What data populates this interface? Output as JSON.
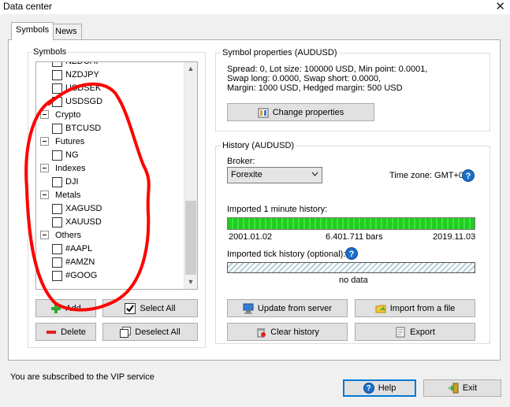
{
  "window": {
    "title": "Data center",
    "close_glyph": "✕"
  },
  "tabs": [
    {
      "label": "Symbols",
      "active": true
    },
    {
      "label": "News",
      "active": false
    }
  ],
  "symbols_group": {
    "title": "Symbols",
    "items": [
      {
        "type": "symbol",
        "label": "NZDCHF"
      },
      {
        "type": "symbol",
        "label": "NZDJPY"
      },
      {
        "type": "symbol",
        "label": "USDSEK"
      },
      {
        "type": "symbol",
        "label": "USDSGD"
      },
      {
        "type": "group",
        "label": "Crypto"
      },
      {
        "type": "symbol",
        "label": "BTCUSD"
      },
      {
        "type": "group",
        "label": "Futures"
      },
      {
        "type": "symbol",
        "label": "NG"
      },
      {
        "type": "group",
        "label": "Indexes"
      },
      {
        "type": "symbol",
        "label": "DJI"
      },
      {
        "type": "group",
        "label": "Metals"
      },
      {
        "type": "symbol",
        "label": "XAGUSD"
      },
      {
        "type": "symbol",
        "label": "XAUUSD"
      },
      {
        "type": "group",
        "label": "Others"
      },
      {
        "type": "symbol",
        "label": "#AAPL"
      },
      {
        "type": "symbol",
        "label": "#AMZN"
      },
      {
        "type": "symbol",
        "label": "#GOOG"
      }
    ],
    "buttons": {
      "add": "Add",
      "select_all": "Select All",
      "delete": "Delete",
      "deselect_all": "Deselect All"
    }
  },
  "symbol_properties": {
    "title": "Symbol properties (AUDUSD)",
    "lines": [
      "Spread: 0, Lot size: 100000 USD, Min point: 0.0001,",
      "Swap long: 0.0000, Swap short: 0.0000,",
      "Margin: 1000 USD, Hedged margin: 500 USD"
    ],
    "change_button": "Change properties"
  },
  "history": {
    "title": "History (AUDUSD)",
    "broker_label": "Broker:",
    "broker_value": "Forexite",
    "timezone_label": "Time zone: GMT+0",
    "minute_label": "Imported 1 minute history:",
    "minute_progress": 1.0,
    "minute_start": "2001.01.02",
    "minute_bars": "6.401.711 bars",
    "minute_end": "2019.11.03",
    "tick_label": "Imported tick history (optional):",
    "tick_status": "no data",
    "buttons": {
      "update": "Update from server",
      "import": "Import from a file",
      "clear": "Clear history",
      "export": "Export"
    }
  },
  "footer": {
    "subscription": "You are subscribed to the VIP service",
    "help": "Help",
    "exit": "Exit"
  },
  "colors": {
    "progress_green": "#25d025",
    "annotation_red": "#ff0000",
    "focus_blue": "#0078d7"
  }
}
